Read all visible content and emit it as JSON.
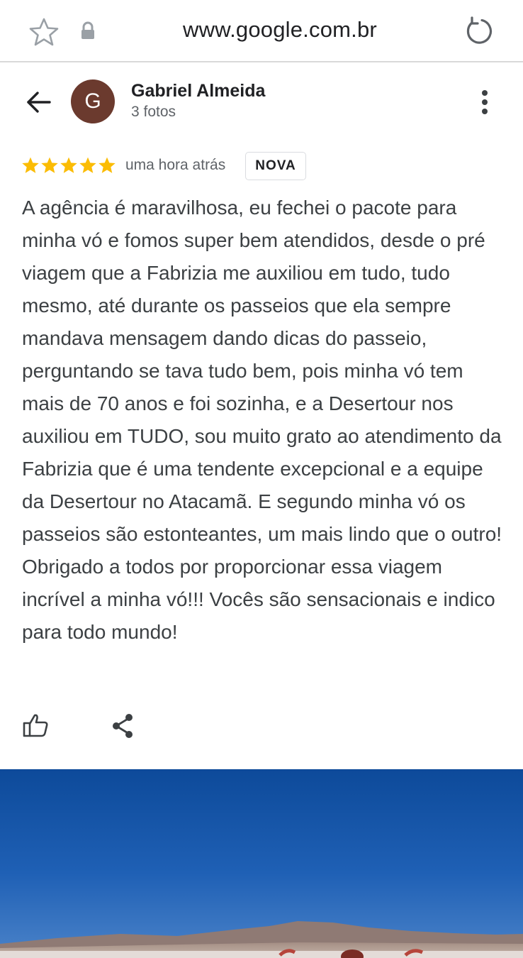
{
  "browser": {
    "url": "www.google.com.br",
    "icons": {
      "bookmark": "star-icon",
      "secure": "lock-icon",
      "reload": "reload-icon"
    }
  },
  "review": {
    "author": {
      "initial": "G",
      "name": "Gabriel Almeida",
      "meta": "3 fotos",
      "avatar_color": "#6b3a2e"
    },
    "rating": 5,
    "rating_max": 5,
    "star_color": "#fbbc04",
    "time_ago": "uma hora atrás",
    "badge": "NOVA",
    "text": "A agência é maravilhosa, eu fechei o pacote para minha vó e fomos super bem atendidos, desde o pré viagem que a Fabrizia me auxiliou em tudo, tudo mesmo, até durante os passeios que ela sempre mandava mensagem dando dicas do passeio, perguntando se tava tudo bem, pois minha vó tem mais de 70 anos e foi sozinha, e a Desertour nos auxiliou em TUDO, sou muito grato ao atendimento da Fabrizia que é uma tendente excepcional e a equipe da Desertour no Atacamã. E segundo minha vó os passeios são estonteantes, um mais lindo que o outro! Obrigado a todos por proporcionar essa viagem incrível a minha vó!!! Vocês são sensacionais e indico para todo mundo!",
    "actions": {
      "like": "thumbs-up-icon",
      "share": "share-icon"
    }
  },
  "photo": {
    "subject": "desert landscape with blue sky",
    "sky_color": "#1f5fb0"
  }
}
